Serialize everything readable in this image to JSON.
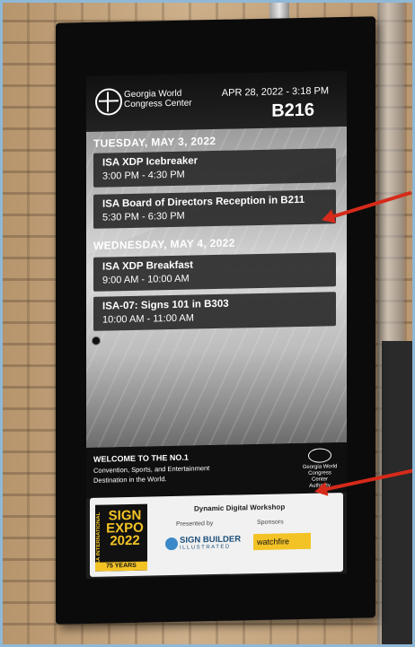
{
  "venue": {
    "logo_icon": "globe-icon",
    "name": "Georgia World Congress Center",
    "datetime": "APR 28, 2022 - 3:18 PM",
    "room": "B216"
  },
  "schedule": [
    {
      "day": "TUESDAY, MAY 3, 2022",
      "events": [
        {
          "title": "ISA XDP Icebreaker",
          "time": "3:00 PM - 4:30 PM"
        },
        {
          "title": "ISA Board of Directors Reception in B211",
          "time": "5:30 PM - 6:30 PM"
        }
      ]
    },
    {
      "day": "WEDNESDAY, MAY 4, 2022",
      "events": [
        {
          "title": "ISA XDP Breakfast",
          "time": "9:00 AM - 10:00 AM"
        },
        {
          "title": "ISA-07: Signs 101 in B303",
          "time": "10:00 AM - 11:00 AM"
        }
      ]
    }
  ],
  "welcome": {
    "heading": "WELCOME TO THE NO.1",
    "body": "Convention, Sports, and Entertainment Destination in the World.",
    "authority": "Georgia World Congress Center Authority"
  },
  "sponsor": {
    "expo_side": "ISA INTERNATIONAL",
    "expo_title": "SIGN EXPO 2022",
    "expo_years": "75 YEARS",
    "workshop": "Dynamic Digital Workshop",
    "presented_by": "Presented by",
    "sponsors_label": "Sponsors",
    "sign_builder": "SIGN BUILDER",
    "sign_builder_sub": "ILLUSTRATED",
    "watchfire": "watchfire"
  },
  "colors": {
    "arrow": "#d62a1a",
    "expo_yellow": "#f3c326",
    "watchfire_yellow": "#f3c326"
  }
}
